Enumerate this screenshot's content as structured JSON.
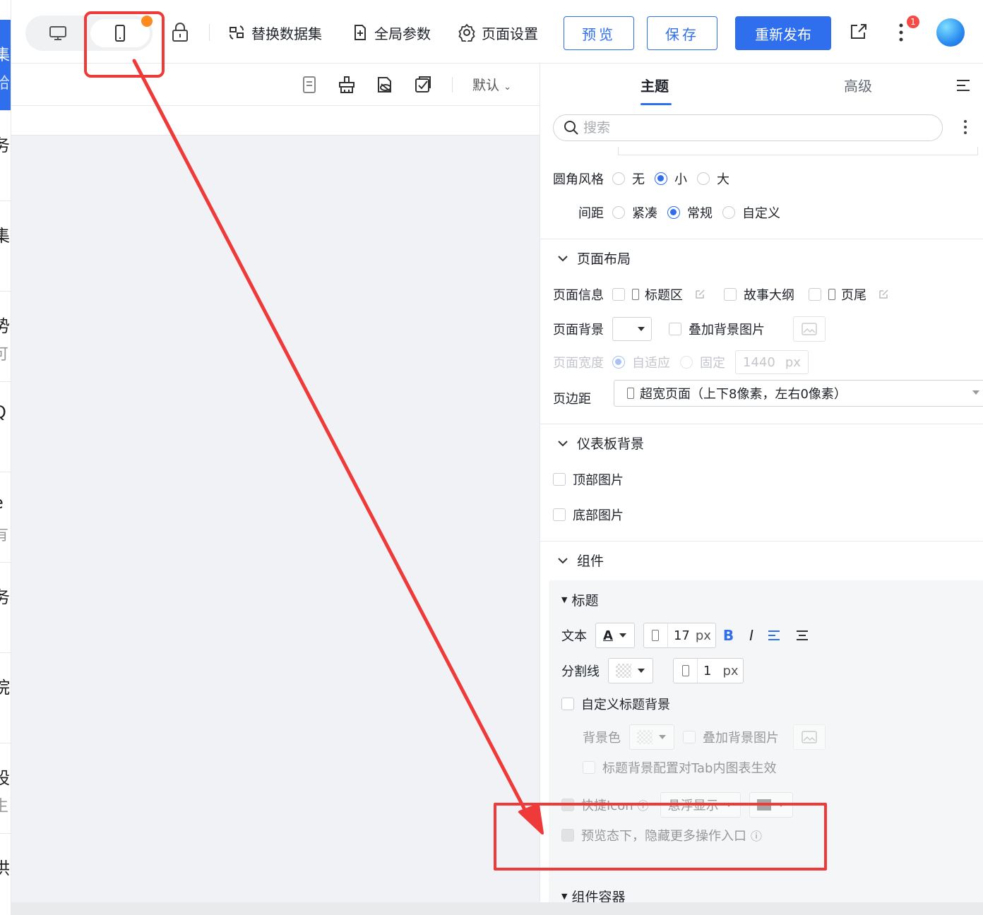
{
  "left_strip": {
    "selected_text_1": "集",
    "selected_text_2": "哈",
    "items": [
      {
        "t1": "务",
        "t2": ""
      },
      {
        "t1": "集",
        "t2": ""
      },
      {
        "t1": "势",
        "t2": "可"
      },
      {
        "t1": "Q",
        "t2": "，"
      },
      {
        "t1": "e",
        "t2": "有"
      },
      {
        "t1": "务",
        "t2": "："
      },
      {
        "t1": "院",
        "t2": ""
      },
      {
        "t1": "股",
        "t2": "生"
      },
      {
        "t1": "供",
        "t2": "："
      }
    ]
  },
  "toolbar": {
    "replace_dataset": "替换数据集",
    "global_params": "全局参数",
    "page_settings": "页面设置",
    "preview": "预览",
    "save": "保存",
    "republish": "重新发布",
    "notification_count": "1"
  },
  "canvas": {
    "default_label": "默认"
  },
  "panel": {
    "tab_theme": "主题",
    "tab_advanced": "高级",
    "search_placeholder": "搜索",
    "corner_style": {
      "label": "圆角风格",
      "options": [
        "无",
        "小",
        "大"
      ],
      "selected": "小"
    },
    "spacing": {
      "label": "间距",
      "options": [
        "紧凑",
        "常规",
        "自定义"
      ],
      "selected": "常规"
    },
    "page_layout": {
      "title": "页面布局",
      "page_info_label": "页面信息",
      "title_area": "标题区",
      "story_outline": "故事大纲",
      "footer": "页尾",
      "page_bg_label": "页面背景",
      "overlay_bg_image": "叠加背景图片",
      "page_width_label": "页面宽度",
      "adaptive": "自适应",
      "fixed": "固定",
      "width_value": "1440",
      "width_unit": "px",
      "margin_label": "页边距",
      "margin_value": "超宽页面（上下8像素，左右0像素）"
    },
    "dashboard_bg": {
      "title": "仪表板背景",
      "top_image": "顶部图片",
      "bottom_image": "底部图片"
    },
    "components": {
      "title": "组件",
      "heading_group": "标题",
      "text_label": "文本",
      "font_size": "17",
      "font_unit": "px",
      "bold": "B",
      "italic": "I",
      "divider_label": "分割线",
      "divider_size": "1",
      "divider_unit": "px",
      "custom_title_bg": "自定义标题背景",
      "bg_color": "背景色",
      "overlay_bg_image": "叠加背景图片",
      "tab_apply": "标题背景配置对Tab内图表生效",
      "show_icon": "快捷Icon",
      "hover_show": "悬浮显示",
      "hide_more_in_preview": "预览态下，隐藏更多操作入口",
      "container_group": "组件容器"
    }
  },
  "colors": {
    "primary": "#2f6fed",
    "annotation": "#ef3a3a",
    "badge_orange": "#ff8a1f",
    "notification_red": "#f54a45"
  }
}
